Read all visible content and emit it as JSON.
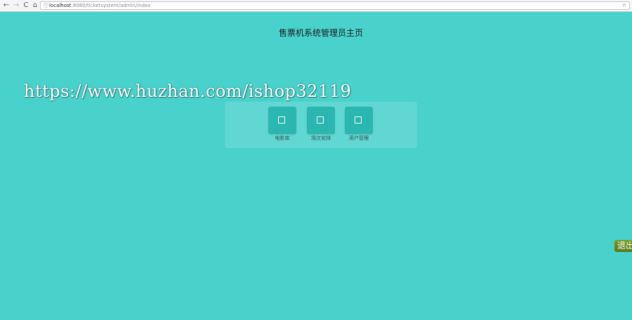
{
  "browser": {
    "back_glyph": "←",
    "forward_glyph": "→",
    "reload_glyph": "C",
    "home_glyph": "⌂",
    "info_glyph": "ⓘ",
    "url_host": "localhost",
    "url_rest": ":8080/ticketsystem/admin/index",
    "star_glyph": "☆"
  },
  "page": {
    "title": "售票机系统管理员主页",
    "watermark": "https://www.huzhan.com/ishop32119",
    "background_color": "#49d1cc"
  },
  "menu": {
    "tiles": [
      {
        "label": "电影库",
        "icon": "square-icon"
      },
      {
        "label": "场次安排",
        "icon": "square-icon"
      },
      {
        "label": "用户管理",
        "icon": "square-icon"
      }
    ],
    "tile_color": "#2cb6b0"
  },
  "logout": {
    "label": "退出",
    "color": "#6a8c22"
  }
}
